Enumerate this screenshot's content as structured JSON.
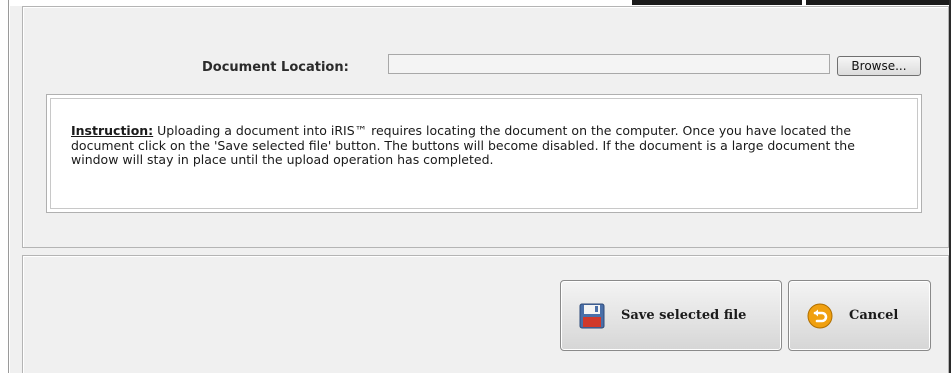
{
  "form": {
    "document_location_label": "Document Location:",
    "document_location_value": "",
    "browse_label": "Browse..."
  },
  "instruction": {
    "heading": "Instruction:",
    "text": " Uploading a document into iRIS™ requires locating the document on the computer. Once you have located the document click on the 'Save selected file' button. The buttons will become disabled. If the document is a large document the window will stay in place until the upload operation has completed."
  },
  "actions": {
    "save_label": "Save selected file",
    "save_icon": "floppy-disk-icon",
    "cancel_label": "Cancel",
    "cancel_icon": "undo-arrow-icon"
  },
  "colors": {
    "cancel_icon": "#f0a010",
    "save_icon": "#4a6fa8"
  }
}
